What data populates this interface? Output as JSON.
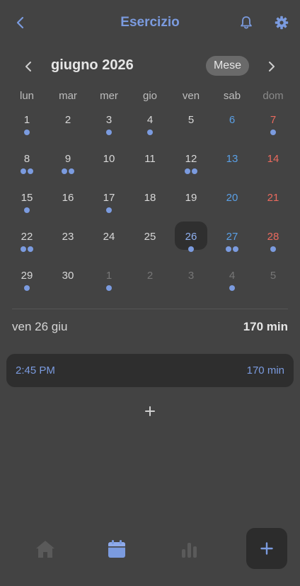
{
  "header": {
    "title": "Esercizio"
  },
  "calendar": {
    "month_title": "giugno 2026",
    "view_mode": "Mese",
    "weekdays": [
      "lun",
      "mar",
      "mer",
      "gio",
      "ven",
      "sab",
      "dom"
    ],
    "weeks": [
      [
        {
          "d": "1",
          "dots": 1
        },
        {
          "d": "2",
          "dots": 0
        },
        {
          "d": "3",
          "dots": 1
        },
        {
          "d": "4",
          "dots": 1
        },
        {
          "d": "5",
          "dots": 0
        },
        {
          "d": "6",
          "dots": 0
        },
        {
          "d": "7",
          "dots": 1
        }
      ],
      [
        {
          "d": "8",
          "dots": 2
        },
        {
          "d": "9",
          "dots": 2
        },
        {
          "d": "10",
          "dots": 0
        },
        {
          "d": "11",
          "dots": 0
        },
        {
          "d": "12",
          "dots": 2
        },
        {
          "d": "13",
          "dots": 0
        },
        {
          "d": "14",
          "dots": 0
        }
      ],
      [
        {
          "d": "15",
          "dots": 1
        },
        {
          "d": "16",
          "dots": 0
        },
        {
          "d": "17",
          "dots": 1
        },
        {
          "d": "18",
          "dots": 0
        },
        {
          "d": "19",
          "dots": 0
        },
        {
          "d": "20",
          "dots": 0
        },
        {
          "d": "21",
          "dots": 0
        }
      ],
      [
        {
          "d": "22",
          "dots": 2
        },
        {
          "d": "23",
          "dots": 0
        },
        {
          "d": "24",
          "dots": 0
        },
        {
          "d": "25",
          "dots": 0
        },
        {
          "d": "26",
          "dots": 1,
          "selected": true
        },
        {
          "d": "27",
          "dots": 2
        },
        {
          "d": "28",
          "dots": 1
        }
      ],
      [
        {
          "d": "29",
          "dots": 1
        },
        {
          "d": "30",
          "dots": 0
        },
        {
          "d": "1",
          "dots": 1,
          "other": true
        },
        {
          "d": "2",
          "dots": 0,
          "other": true
        },
        {
          "d": "3",
          "dots": 0,
          "other": true
        },
        {
          "d": "4",
          "dots": 1,
          "other": true
        },
        {
          "d": "5",
          "dots": 0,
          "other": true
        }
      ]
    ]
  },
  "day_summary": {
    "date_label": "ven 26 giu",
    "total": "170 min"
  },
  "entries": [
    {
      "time": "2:45 PM",
      "duration": "170 min"
    }
  ],
  "colors": {
    "accent": "#7b9bdf",
    "saturday": "#5aa0e6",
    "sunday": "#ea6a5e",
    "background": "#434343"
  },
  "icons": {
    "back": "chevron-left-icon",
    "bell": "bell-icon",
    "settings": "gear-icon",
    "prev_month": "chevron-left-icon",
    "next_month": "chevron-right-icon",
    "add_entry": "plus-icon",
    "nav_home": "home-icon",
    "nav_calendar": "calendar-icon",
    "nav_stats": "bar-chart-icon",
    "fab": "plus-icon"
  },
  "bottom_nav": {
    "active": "calendar"
  }
}
